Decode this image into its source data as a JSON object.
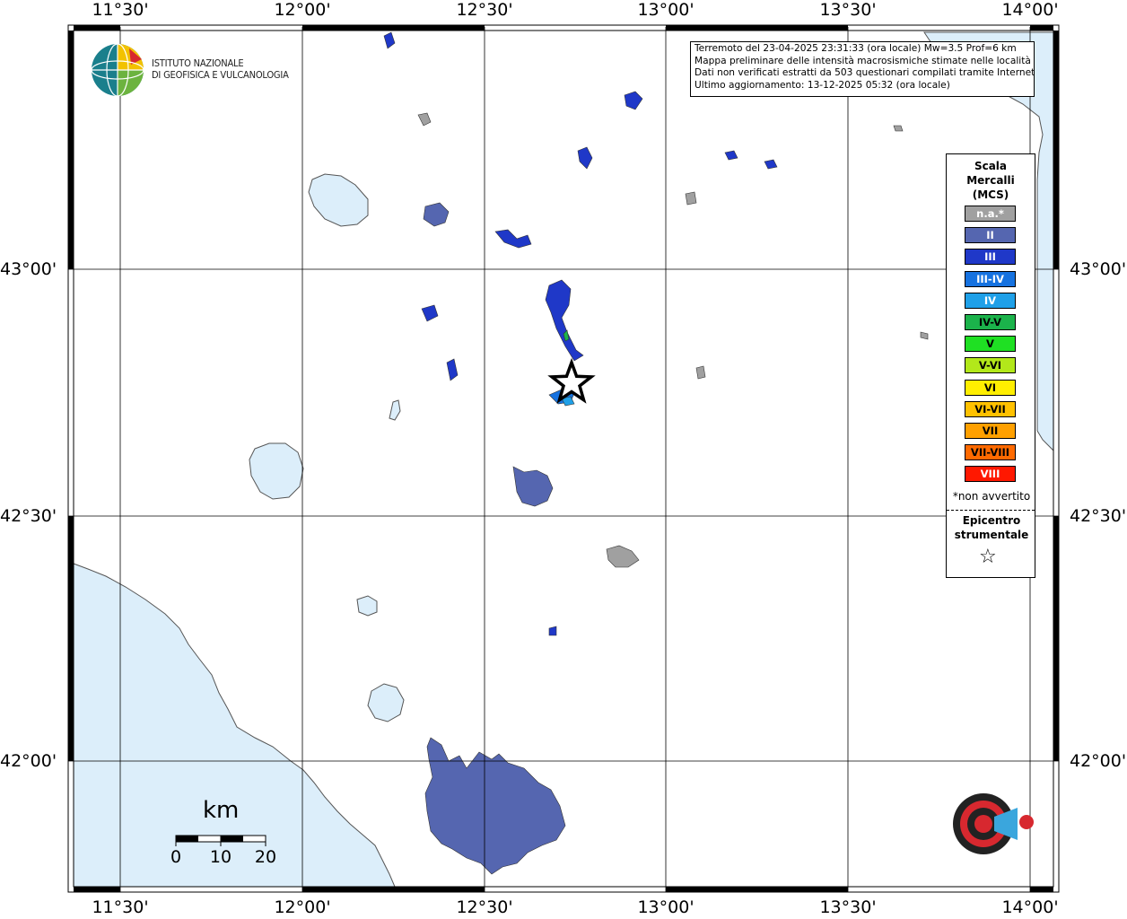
{
  "map": {
    "lon_ticks": [
      "11°30'",
      "12°00'",
      "12°30'",
      "13°00'",
      "13°30'",
      "14°00'"
    ],
    "lat_ticks": [
      "43°00'",
      "42°30'",
      "42°00'"
    ]
  },
  "info_box": {
    "line1": "Terremoto del 23-04-2025 23:31:33 (ora locale) Mw=3.5 Prof=6 km",
    "line2": "Mappa preliminare delle intensità macrosismiche stimate nelle località",
    "line3": "Dati non verificati estratti da 503 questionari compilati tramite Internet.",
    "line4": "Ultimo aggiornamento: 13-12-2025 05:32 (ora locale)"
  },
  "logo": {
    "line1": "ISTITUTO NAZIONALE",
    "line2": "DI GEOFISICA E VULCANOLOGIA"
  },
  "legend": {
    "title": "Scala\nMercalli\n(MCS)",
    "items": [
      {
        "label": "n.a.*",
        "color": "#a0a0a0",
        "text_color": "#ffffff"
      },
      {
        "label": "II",
        "color": "#5566b0",
        "text_color": "#ffffff"
      },
      {
        "label": "III",
        "color": "#1f38c8",
        "text_color": "#ffffff"
      },
      {
        "label": "III-IV",
        "color": "#1672e0",
        "text_color": "#ffffff"
      },
      {
        "label": "IV",
        "color": "#1fa0e8",
        "text_color": "#ffffff"
      },
      {
        "label": "IV-V",
        "color": "#1bb34b",
        "text_color": "#000000"
      },
      {
        "label": "V",
        "color": "#1fe023",
        "text_color": "#000000"
      },
      {
        "label": "V-VI",
        "color": "#b2e81a",
        "text_color": "#000000"
      },
      {
        "label": "VI",
        "color": "#ffee00",
        "text_color": "#000000"
      },
      {
        "label": "VI-VII",
        "color": "#ffc100",
        "text_color": "#000000"
      },
      {
        "label": "VII",
        "color": "#ffa000",
        "text_color": "#000000"
      },
      {
        "label": "VII-VIII",
        "color": "#ff6a00",
        "text_color": "#000000"
      },
      {
        "label": "VIII",
        "color": "#ff1800",
        "text_color": "#ffffff"
      }
    ],
    "note": "*non avvertito",
    "epicenter_label": "Epicentro\nstrumentale",
    "epicenter_symbol": "☆"
  },
  "scalebar": {
    "unit": "km",
    "labels": [
      "0",
      "10",
      "20"
    ]
  },
  "colors": {
    "sea": "#dceefa",
    "land": "#ffffff",
    "grid": "#000000"
  }
}
